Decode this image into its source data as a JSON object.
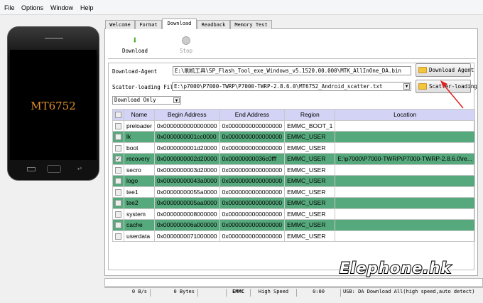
{
  "menu": [
    "File",
    "Options",
    "Window",
    "Help"
  ],
  "phone": {
    "chip": "MT6752"
  },
  "tabs": [
    "Welcome",
    "Format",
    "Download",
    "Readback",
    "Memory Test"
  ],
  "toolbar": {
    "download": "Download",
    "stop": "Stop"
  },
  "da": {
    "label": "Download-Agent",
    "value": "E:\\刷机工具\\SP_Flash_Tool_exe_Windows_v5.1520.00.000\\MTK_AllInOne_DA.bin",
    "button": "Download Agent"
  },
  "scatter": {
    "label": "Scatter-loading File",
    "value": "E:\\p7000\\P7000-TWRP\\P7000-TWRP-2.8.6.0\\MT6752_Android_scatter.txt",
    "button": "Scatter-loading"
  },
  "mode": "Download Only",
  "table": {
    "headers": [
      "Name",
      "Begin Address",
      "End Address",
      "Region",
      "Location"
    ],
    "rows": [
      [
        "preloader",
        "0x0000000000000000",
        "0x0000000000000000",
        "EMMC_BOOT_1",
        "",
        false
      ],
      [
        "lk",
        "0x0000000001cc0000",
        "0x0000000000000000",
        "EMMC_USER",
        "",
        false
      ],
      [
        "boot",
        "0x0000000001d20000",
        "0x0000000000000000",
        "EMMC_USER",
        "",
        false
      ],
      [
        "recovery",
        "0x0000000002d20000",
        "0x00000000036c0fff",
        "EMMC_USER",
        "E:\\p7000\\P7000-TWRP\\P7000-TWRP-2.8.6.0\\re...",
        true
      ],
      [
        "secro",
        "0x0000000003d20000",
        "0x0000000000000000",
        "EMMC_USER",
        "",
        false
      ],
      [
        "logo",
        "0x00000000043a0000",
        "0x0000000000000000",
        "EMMC_USER",
        "",
        false
      ],
      [
        "tee1",
        "0x00000000055a0000",
        "0x0000000000000000",
        "EMMC_USER",
        "",
        false
      ],
      [
        "tee2",
        "0x0000000005aa0000",
        "0x0000000000000000",
        "EMMC_USER",
        "",
        false
      ],
      [
        "system",
        "0x0000000008000000",
        "0x0000000000000000",
        "EMMC_USER",
        "",
        false
      ],
      [
        "cache",
        "0x000000006a000000",
        "0x0000000000000000",
        "EMMC_USER",
        "",
        false
      ],
      [
        "userdata",
        "0x0000000071000000",
        "0x0000000000000000",
        "EMMC_USER",
        "",
        false
      ]
    ]
  },
  "status": {
    "speed": "0 B/s",
    "bytes": "0 Bytes",
    "storage": "EMMC",
    "mode": "High Speed",
    "time": "0:00",
    "usb": "USB: DA Download All(high speed,auto detect)"
  },
  "watermark": "Elephone.hk"
}
